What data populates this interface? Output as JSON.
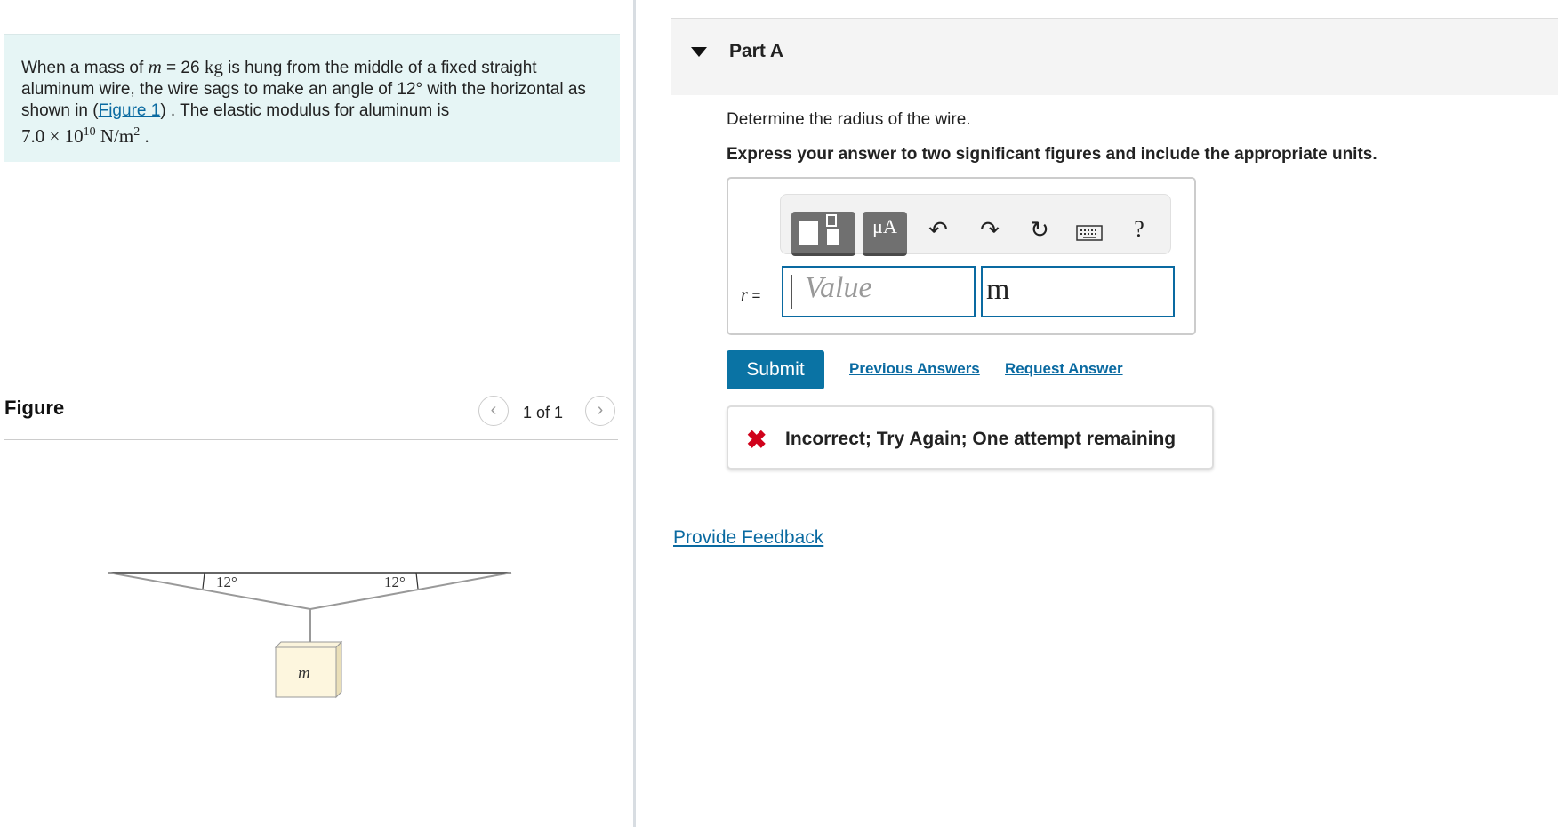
{
  "problem": {
    "text_1": "When a mass of ",
    "m_var": "m",
    "text_eq": " = 26 ",
    "unit_kg": "kg",
    "text_2": " is hung from the middle of a fixed straight aluminum wire, the wire sags to make an angle of 12° with the horizontal as shown in (",
    "figure_link": "Figure 1",
    "text_3": ") . The elastic modulus for aluminum is",
    "modulus": "7.0 × 10",
    "modulus_exp": "10",
    "modulus_unit": " N/m",
    "modulus_unit_exp": "2",
    "modulus_end": " ."
  },
  "figure": {
    "title": "Figure",
    "prev_icon": "chevron-left-icon",
    "next_icon": "chevron-right-icon",
    "count": "1 of 1",
    "angle_left": "12°",
    "angle_right": "12°",
    "mass_label": "m"
  },
  "part": {
    "title": "Part A",
    "question": "Determine the radius of the wire.",
    "instruction": "Express your answer to two significant figures and include the appropriate units."
  },
  "toolbar": {
    "templates_icon": "templates-icon",
    "units_label": "μA",
    "undo_icon": "undo-icon",
    "redo_icon": "redo-icon",
    "reset_icon": "reset-icon",
    "keyboard_icon": "keyboard-icon",
    "help_label": "?"
  },
  "answer": {
    "variable": "r",
    "equals": " =",
    "value_placeholder": "Value",
    "unit_value": "m"
  },
  "actions": {
    "submit": "Submit",
    "previous_answers": "Previous Answers",
    "request_answer": "Request Answer"
  },
  "feedback": {
    "icon": "x-icon",
    "message": "Incorrect; Try Again; One attempt remaining",
    "color": "#d0021b"
  },
  "provide_feedback": "Provide Feedback",
  "colors": {
    "problem_bg": "#e6f5f5",
    "accent": "#0a73a4",
    "link": "#0a6aa1"
  }
}
